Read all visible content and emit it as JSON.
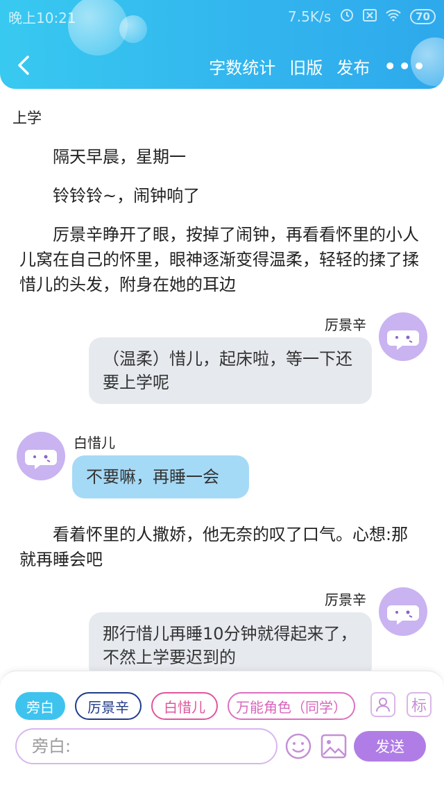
{
  "status_bar": {
    "time": "晚上10:21",
    "network_speed": "7.5K/s",
    "battery": "70"
  },
  "nav": {
    "word_count": "字数统计",
    "old_version": "旧版",
    "publish": "发布",
    "more": "•••"
  },
  "chapter": {
    "title": "上学"
  },
  "content": {
    "para1": "隔天早晨，星期一",
    "para2": "铃铃铃~，闹钟响了",
    "para3": "厉景辛睁开了眼，按掉了闹钟，再看看怀里的小人儿窝在自己的怀里，眼神逐渐变得温柔，轻轻的揉了揉惜儿的头发，附身在她的耳边",
    "msg1_name": "厉景辛",
    "msg1_text": "（温柔）惜儿，起床啦，等一下还要上学呢",
    "msg2_name": "白惜儿",
    "msg2_text": "不要嘛，再睡一会",
    "para4": "看着怀里的人撒娇，他无奈的叹了口气。心想:那就再睡会吧",
    "msg3_name": "厉景辛",
    "msg3_text": "那行惜儿再睡10分钟就得起来了，不然上学要迟到的"
  },
  "roles": {
    "narration": "旁白",
    "role1": "厉景辛",
    "role2": "白惜儿",
    "role3": "万能角色（同学）"
  },
  "tools": {
    "mark": "标"
  },
  "input": {
    "placeholder": "旁白:"
  },
  "send_label": "发送",
  "colors": {
    "header": "#33b7ee",
    "avatar": "#c9b3f1",
    "send": "#b07de6",
    "bubble_grey": "#e6e9ee",
    "bubble_blue": "#a5daf6"
  }
}
